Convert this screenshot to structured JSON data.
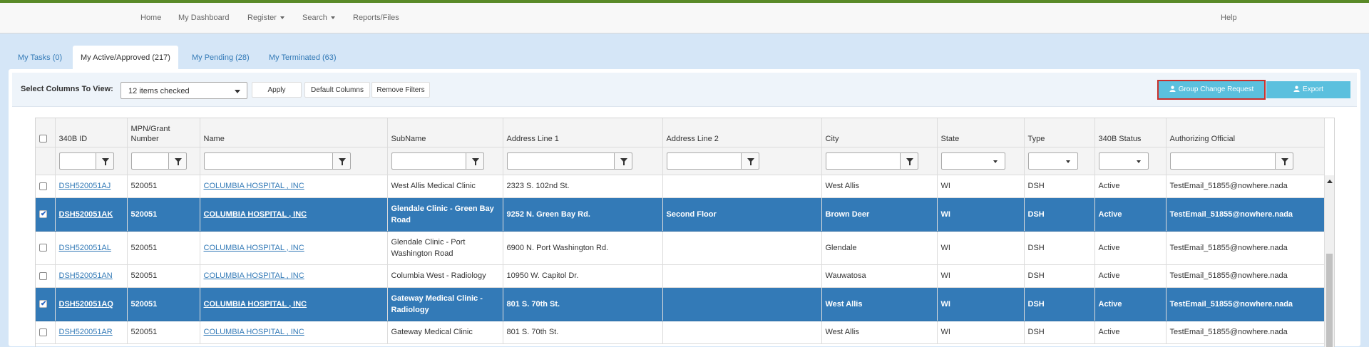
{
  "nav": {
    "home": "Home",
    "dashboard": "My Dashboard",
    "register": "Register",
    "search": "Search",
    "reports": "Reports/Files",
    "help": "Help"
  },
  "tabs": [
    {
      "label": "My Tasks (0)",
      "active": false
    },
    {
      "label": "My Active/Approved (217)",
      "active": true
    },
    {
      "label": "My Pending (28)",
      "active": false
    },
    {
      "label": "My Terminated (63)",
      "active": false
    }
  ],
  "toolbar": {
    "select_columns_label": "Select Columns To View:",
    "columns_selected": "12 items checked",
    "apply": "Apply",
    "default_columns": "Default Columns",
    "remove_filters": "Remove Filters",
    "group_change_request": "Group Change Request",
    "export": "Export"
  },
  "columns": [
    "340B ID",
    "MPN/Grant Number",
    "Name",
    "SubName",
    "Address Line 1",
    "Address Line 2",
    "City",
    "State",
    "Type",
    "340B Status",
    "Authorizing Official"
  ],
  "rows": [
    {
      "checked": false,
      "id": "DSH520051AJ",
      "mpn": "520051",
      "name": "COLUMBIA HOSPITAL , INC",
      "subname": "West Allis Medical Clinic",
      "addr1": "2323 S. 102nd St.",
      "addr2": "",
      "city": "West Allis",
      "state": "WI",
      "type": "DSH",
      "status": "Active",
      "official": "TestEmail_51855@nowhere.nada"
    },
    {
      "checked": true,
      "id": "DSH520051AK",
      "mpn": "520051",
      "name": "COLUMBIA HOSPITAL , INC",
      "subname": "Glendale Clinic - Green Bay Road",
      "addr1": "9252 N. Green Bay Rd.",
      "addr2": "Second Floor",
      "city": "Brown Deer",
      "state": "WI",
      "type": "DSH",
      "status": "Active",
      "official": "TestEmail_51855@nowhere.nada"
    },
    {
      "checked": false,
      "id": "DSH520051AL",
      "mpn": "520051",
      "name": "COLUMBIA HOSPITAL , INC",
      "subname": "Glendale Clinic - Port Washington Road",
      "addr1": "6900 N. Port Washington Rd.",
      "addr2": "",
      "city": "Glendale",
      "state": "WI",
      "type": "DSH",
      "status": "Active",
      "official": "TestEmail_51855@nowhere.nada"
    },
    {
      "checked": false,
      "id": "DSH520051AN",
      "mpn": "520051",
      "name": "COLUMBIA HOSPITAL , INC",
      "subname": "Columbia West - Radiology",
      "addr1": "10950 W. Capitol Dr.",
      "addr2": "",
      "city": "Wauwatosa",
      "state": "WI",
      "type": "DSH",
      "status": "Active",
      "official": "TestEmail_51855@nowhere.nada"
    },
    {
      "checked": true,
      "id": "DSH520051AQ",
      "mpn": "520051",
      "name": "COLUMBIA HOSPITAL , INC",
      "subname": "Gateway Medical Clinic - Radiology",
      "addr1": "801 S. 70th St.",
      "addr2": "",
      "city": "West Allis",
      "state": "WI",
      "type": "DSH",
      "status": "Active",
      "official": "TestEmail_51855@nowhere.nada"
    },
    {
      "checked": false,
      "id": "DSH520051AR",
      "mpn": "520051",
      "name": "COLUMBIA HOSPITAL , INC",
      "subname": "Gateway Medical Clinic",
      "addr1": "801 S. 70th St.",
      "addr2": "",
      "city": "West Allis",
      "state": "WI",
      "type": "DSH",
      "status": "Active",
      "official": "TestEmail_51855@nowhere.nada"
    }
  ]
}
